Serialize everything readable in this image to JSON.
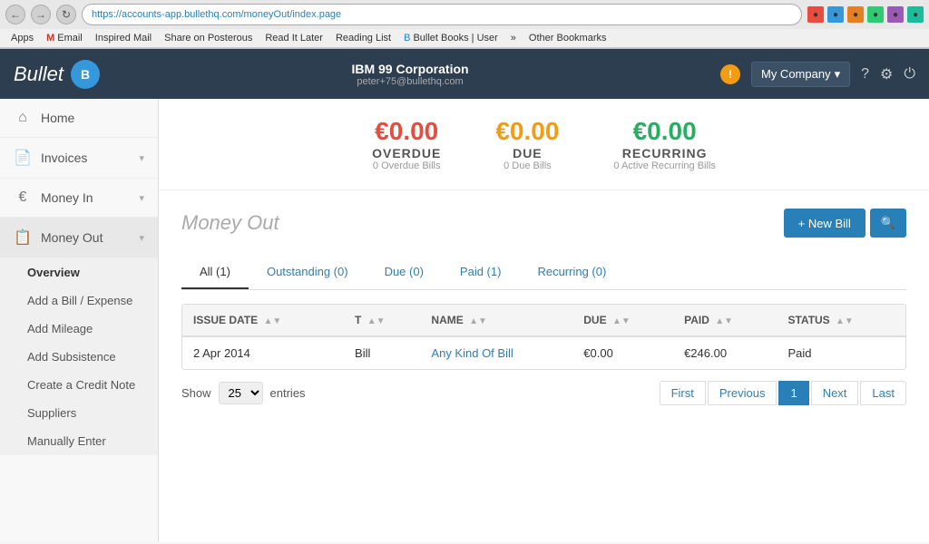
{
  "browser": {
    "url": "https://accounts-app.bullethq.com/moneyOut/index.page",
    "back_label": "←",
    "forward_label": "→",
    "refresh_label": "↻",
    "bookmarks": [
      {
        "label": "Apps"
      },
      {
        "label": "Email",
        "icon": "M"
      },
      {
        "label": "Inspired Mail"
      },
      {
        "label": "Share on Posterous"
      },
      {
        "label": "Read It Later"
      },
      {
        "label": "Reading List"
      },
      {
        "label": "Bullet Books | User"
      },
      {
        "label": "»"
      },
      {
        "label": "Other Bookmarks"
      }
    ]
  },
  "topnav": {
    "logo_text": "Bullet",
    "logo_icon": "B",
    "company_name": "IBM 99 Corporation",
    "user_email": "peter+75@bullethq.com",
    "my_company_label": "My Company",
    "warning_label": "!",
    "help_label": "?",
    "settings_label": "⚙",
    "power_label": "⏻"
  },
  "sidebar": {
    "items": [
      {
        "label": "Home",
        "icon": "⌂"
      },
      {
        "label": "Invoices",
        "icon": "📄",
        "has_arrow": true
      },
      {
        "label": "Money In",
        "icon": "€",
        "has_arrow": true
      },
      {
        "label": "Money Out",
        "icon": "📋",
        "has_arrow": true,
        "active": true
      }
    ],
    "sub_items": [
      {
        "label": "Overview",
        "active": true
      },
      {
        "label": "Add a Bill / Expense"
      },
      {
        "label": "Add Mileage"
      },
      {
        "label": "Add Subsistence"
      },
      {
        "label": "Create a Credit Note"
      },
      {
        "label": "Suppliers"
      },
      {
        "label": "Manually Enter"
      }
    ]
  },
  "summary": {
    "overdue": {
      "amount": "€0.00",
      "label": "OVERDUE",
      "sub": "0 Overdue Bills"
    },
    "due": {
      "amount": "€0.00",
      "label": "DUE",
      "sub": "0 Due Bills"
    },
    "recurring": {
      "amount": "€0.00",
      "label": "RECURRING",
      "sub": "0 Active Recurring Bills"
    }
  },
  "page": {
    "title": "Money Out",
    "new_bill_label": "+ New Bill",
    "search_icon": "🔍"
  },
  "tabs": [
    {
      "label": "All (1)",
      "active": true
    },
    {
      "label": "Outstanding (0)"
    },
    {
      "label": "Due (0)"
    },
    {
      "label": "Paid (1)"
    },
    {
      "label": "Recurring (0)"
    }
  ],
  "table": {
    "columns": [
      {
        "label": "ISSUE DATE"
      },
      {
        "label": "T"
      },
      {
        "label": "NAME"
      },
      {
        "label": "DUE"
      },
      {
        "label": "PAID"
      },
      {
        "label": "STATUS"
      }
    ],
    "rows": [
      {
        "issue_date": "2 Apr 2014",
        "type": "Bill",
        "name": "Any Kind Of Bill",
        "due": "€0.00",
        "paid": "€246.00",
        "status": "Paid"
      }
    ]
  },
  "pagination": {
    "show_label": "Show",
    "entries_value": "25",
    "entries_label": "entries",
    "buttons": [
      {
        "label": "First"
      },
      {
        "label": "Previous"
      },
      {
        "label": "1",
        "active": true
      },
      {
        "label": "Next"
      },
      {
        "label": "Last"
      }
    ]
  }
}
